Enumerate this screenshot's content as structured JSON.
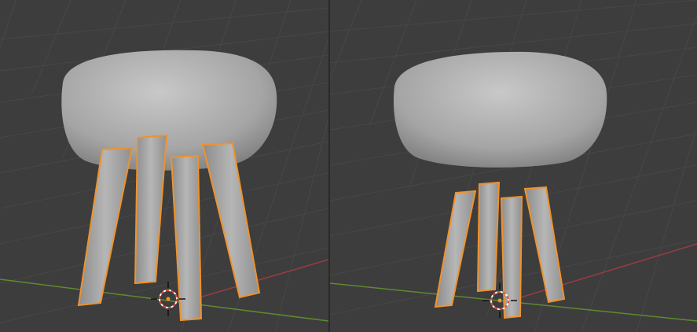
{
  "viewports": [
    {
      "id": "left",
      "label": "",
      "selected_objects": [
        "leg-1",
        "leg-2",
        "leg-3",
        "leg-4"
      ],
      "active_tool": "3d-cursor"
    },
    {
      "id": "right",
      "label": "",
      "selected_objects": [
        "leg-1",
        "leg-2",
        "leg-3",
        "leg-4"
      ],
      "active_tool": "3d-cursor"
    }
  ],
  "colors": {
    "background": "#3d3d3d",
    "grid": "#474747",
    "x_axis": "#9a3c40",
    "y_axis": "#5e8a2e",
    "selection_outline": "#f0922b",
    "mesh_light": "#c4c4c4",
    "mesh_dark": "#707070",
    "cursor_ring_a": "#e74c3c",
    "cursor_ring_b": "#ffffff"
  },
  "icons": {
    "cursor": "3d-cursor-icon",
    "origin": "object-origin-icon"
  }
}
